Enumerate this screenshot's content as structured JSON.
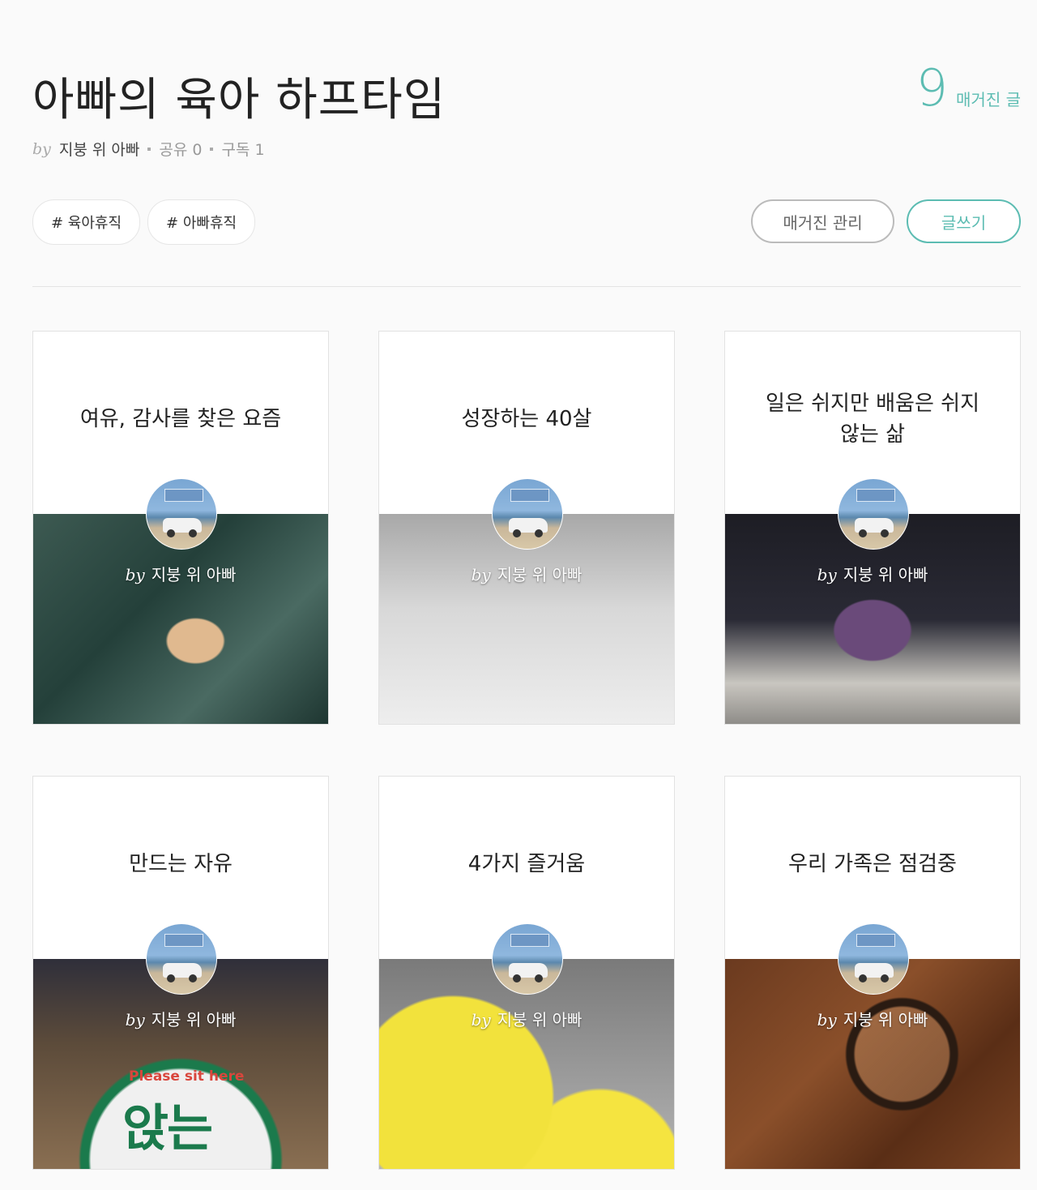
{
  "magazine": {
    "title": "아빠의 육아 하프타임",
    "article_count": "9",
    "article_count_label": "매거진 글",
    "by": "by",
    "author": "지붕 위 아빠",
    "share_label": "공유 0",
    "subscribe_label": "구독 1"
  },
  "tags": [
    "# 육아휴직",
    "# 아빠휴직"
  ],
  "actions": {
    "manage_label": "매거진 관리",
    "write_label": "글쓰기"
  },
  "cards": [
    {
      "title": "여유, 감사를 찾은 요즘",
      "by": "by",
      "author": "지붕 위 아빠"
    },
    {
      "title": "성장하는 40살",
      "by": "by",
      "author": "지붕 위 아빠"
    },
    {
      "title": "일은 쉬지만 배움은 쉬지 않는 삶",
      "by": "by",
      "author": "지붕 위 아빠"
    },
    {
      "title": "만드는 자유",
      "by": "by",
      "author": "지붕 위 아빠",
      "image_text": [
        "Please sit here",
        "앉는"
      ]
    },
    {
      "title": "4가지 즐거움",
      "by": "by",
      "author": "지붕 위 아빠"
    },
    {
      "title": "우리 가족은 점검중",
      "by": "by",
      "author": "지붕 위 아빠"
    }
  ],
  "colors": {
    "accent": "#5cbcb2"
  }
}
